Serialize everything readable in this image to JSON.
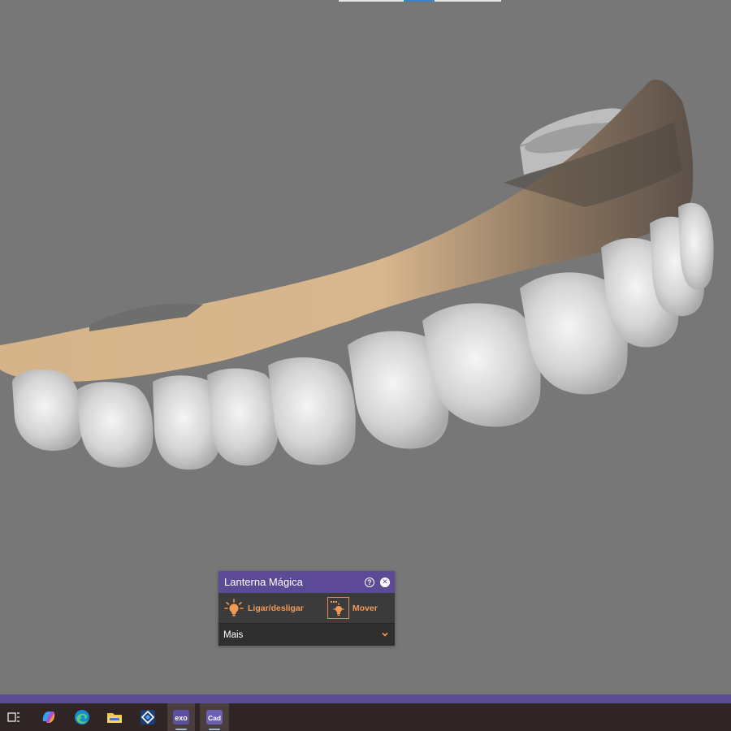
{
  "panel": {
    "title": "Lanterna Mágica",
    "help_icon": "help-icon",
    "close_icon": "close-icon",
    "tools": [
      {
        "label": "Ligar/desligar",
        "icon": "lightbulb-icon"
      },
      {
        "label": "Mover",
        "icon": "move-lamp-icon"
      }
    ],
    "more_label": "Mais",
    "more_icon": "chevron-down-icon"
  },
  "taskbar": {
    "items": [
      {
        "name": "task-view-icon"
      },
      {
        "name": "copilot-icon"
      },
      {
        "name": "edge-browser-icon"
      },
      {
        "name": "file-explorer-icon"
      },
      {
        "name": "app-icon"
      },
      {
        "name": "exocad-icon",
        "label": "exo"
      },
      {
        "name": "cad-app-icon",
        "label": "Cad"
      }
    ]
  },
  "colors": {
    "viewport_bg": "#777777",
    "panel_header": "#5c4a97",
    "panel_body": "#3b3b3b",
    "accent_orange": "#f39a57",
    "gingiva": "#d9b78e",
    "teeth": "#d8d8d8",
    "accent_strip": "#5a4d92",
    "taskbar_bg": "#2f2524"
  }
}
